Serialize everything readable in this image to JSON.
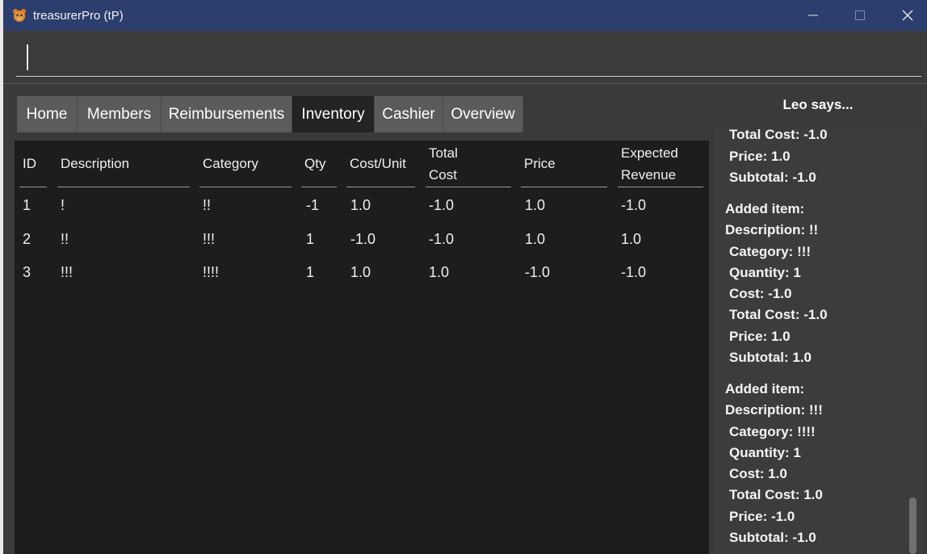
{
  "window": {
    "title": "treasurerPro (tP)"
  },
  "command": {
    "value": ""
  },
  "tabs": [
    "Home",
    "Members",
    "Reimbursements",
    "Inventory",
    "Cashier",
    "Overview"
  ],
  "active_tab": "Inventory",
  "table": {
    "headers": {
      "id": "ID",
      "description": "Description",
      "category": "Category",
      "qty": "Qty",
      "cost_unit": "Cost/Unit",
      "total_cost_1": "Total",
      "total_cost_2": "Cost",
      "price": "Price",
      "revenue_1": "Expected",
      "revenue_2": "Revenue"
    },
    "rows": [
      [
        "1",
        "!",
        "!!",
        "-1",
        "1.0",
        "-1.0",
        "1.0",
        "-1.0"
      ],
      [
        "2",
        "!!",
        "!!!",
        "1",
        "-1.0",
        "-1.0",
        "1.0",
        "1.0"
      ],
      [
        "3",
        "!!!",
        "!!!!",
        "1",
        "1.0",
        "1.0",
        "-1.0",
        "-1.0"
      ]
    ]
  },
  "leo": {
    "title": "Leo says...",
    "lines": [
      "Total Cost: -1.0",
      "Price: 1.0",
      "Subtotal: -1.0",
      "Added item:",
      "Description: !!",
      "Category: !!!",
      "Quantity: 1",
      "Cost: -1.0",
      "Total Cost: -1.0",
      "Price: 1.0",
      "Subtotal: 1.0",
      "Added item:",
      "Description: !!!",
      "Category: !!!!",
      "Quantity: 1",
      "Cost: 1.0",
      "Total Cost: 1.0",
      "Price: -1.0",
      "Subtotal: -1.0"
    ]
  },
  "colors": {
    "titlebar": "#2c3e6e",
    "active_tab": "#232323",
    "tab": "#5b5b5b",
    "table_bg": "#1d1d1d"
  },
  "icons": {
    "app": "bear-icon",
    "minimize": "minimize-icon",
    "maximize": "maximize-icon",
    "close": "close-icon"
  }
}
